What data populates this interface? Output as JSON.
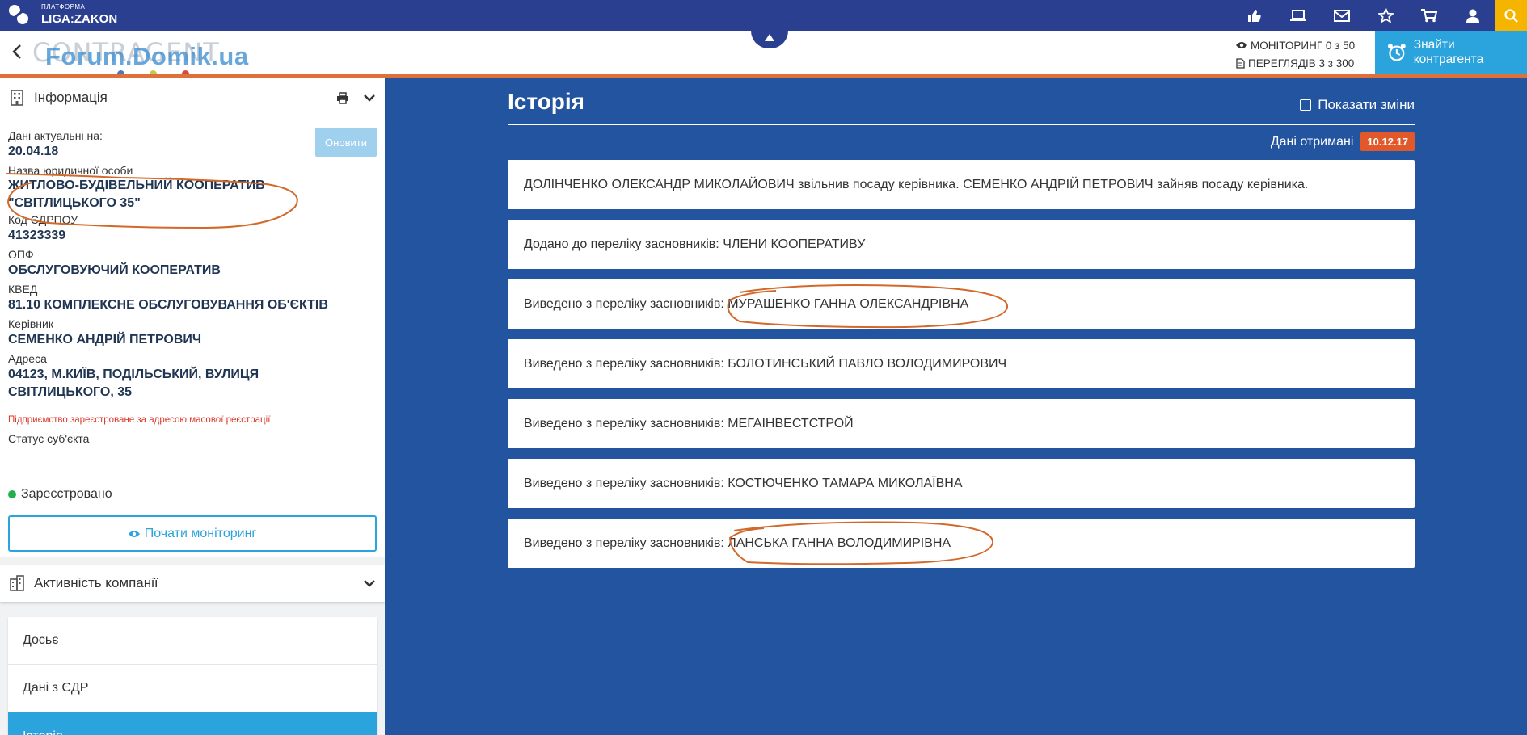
{
  "topbar": {
    "logo_small": "ПЛАТФОРМА",
    "logo_big": "LIGA:ZAKON",
    "icons": [
      "thumbs-up-icon",
      "laptop-icon",
      "envelope-icon",
      "star-icon",
      "cart-icon",
      "user-icon",
      "search-icon"
    ]
  },
  "header": {
    "app_title": "CONTRAGENT",
    "watermark": "Forum.Domik.ua",
    "monitoring_label": "МОНІТОРИНГ 0 з 50",
    "views_label": "ПЕРЕГЛЯДІВ 3 з 300",
    "find_button": "Знайти контрагента"
  },
  "info_panel": {
    "title": "Інформація",
    "refresh_button": "Оновити",
    "fields": {
      "actual_label": "Дані актуальні на:",
      "actual_value": "20.04.18",
      "name_label": "Назва юридичної особи",
      "name_line1": "ЖИТЛОВО-БУДІВЕЛЬНИЙ КООПЕРАТИВ",
      "name_line2": "\"СВІТЛИЦЬКОГО 35\"",
      "edrpou_label": "Код ЄДРПОУ",
      "edrpou_value": "41323339",
      "opf_label": "ОПФ",
      "opf_value": "ОБСЛУГОВУЮЧИЙ КООПЕРАТИВ",
      "kved_label": "КВЕД",
      "kved_value": "81.10 КОМПЛЕКСНЕ ОБСЛУГОВУВАННЯ ОБ'ЄКТІВ",
      "head_label": "Керівник",
      "head_value": "СЕМЕНКО АНДРІЙ ПЕТРОВИЧ",
      "address_label": "Адреса",
      "address_line1": "04123, М.КИЇВ, ПОДІЛЬСЬКИЙ, ВУЛИЦЯ",
      "address_line2": "СВІТЛИЦЬКОГО, 35",
      "address_note": "Підприємство зареєстроване за адресою масової реєстрації",
      "status_label": "Статус суб'єкта",
      "status_value": "Зареєстровано"
    },
    "monitor_button": "Почати моніторинг"
  },
  "activity_panel": {
    "title": "Активність компанії",
    "menu": [
      {
        "label": "Досьє"
      },
      {
        "label": "Дані з ЄДР"
      },
      {
        "label": "Історія"
      }
    ]
  },
  "history": {
    "title": "Історія",
    "show_changes": "Показати зміни",
    "received_label": "Дані отримані",
    "received_date": "10.12.17",
    "entries": [
      {
        "text": "ДОЛІНЧЕНКО ОЛЕКСАНДР МИКОЛАЙОВИЧ звільнив посаду керівника. СЕМЕНКО АНДРІЙ ПЕТРОВИЧ зайняв посаду керівника."
      },
      {
        "text": "Додано до переліку засновників: ЧЛЕНИ КООПЕРАТИВУ"
      },
      {
        "text": "Виведено з переліку засновників: МУРАШЕНКО ГАННА ОЛЕКСАНДРІВНА"
      },
      {
        "text": "Виведено з переліку засновників: БОЛОТИНСЬКИЙ ПАВЛО ВОЛОДИМИРОВИЧ"
      },
      {
        "text": "Виведено з переліку засновників: МЕГАІНВЕСТСТРОЙ"
      },
      {
        "text": "Виведено з переліку засновників: КОСТЮЧЕНКО ТАМАРА МИКОЛАЇВНА"
      },
      {
        "text": "Виведено з переліку засновників: ЛАНСЬКА ГАННА ВОЛОДИМИРІВНА"
      }
    ]
  },
  "colors": {
    "topbar": "#2a3f8f",
    "main_bg": "#2354a0",
    "accent": "#2ba3dc",
    "badge": "#e1592a",
    "annotation": "#d2692a"
  }
}
